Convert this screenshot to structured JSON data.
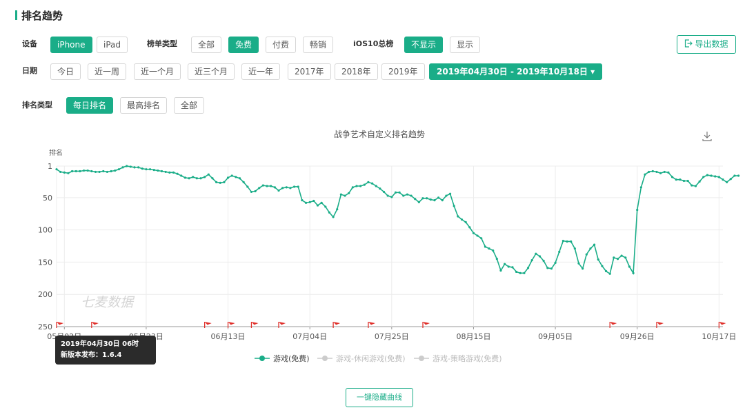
{
  "page": {
    "title": "排名趋势",
    "export_label": "导出数据",
    "hide_curves_label": "一键隐藏曲线",
    "watermark": "七麦数据"
  },
  "filters": {
    "device": {
      "label": "设备",
      "options": [
        "iPhone",
        "iPad"
      ],
      "selected": "iPhone"
    },
    "list_type": {
      "label": "榜单类型",
      "options": [
        "全部",
        "免费",
        "付费",
        "畅销"
      ],
      "selected": "免费"
    },
    "ios10": {
      "label": "iOS10总榜",
      "options": [
        "不显示",
        "显示"
      ],
      "selected": "不显示"
    },
    "date": {
      "label": "日期",
      "options": [
        "今日",
        "近一周",
        "近一个月",
        "近三个月",
        "近一年",
        "2017年",
        "2018年",
        "2019年"
      ],
      "range": "2019年04月30日 - 2019年10月18日 ▾"
    },
    "rank_type": {
      "label": "排名类型",
      "options": [
        "每日排名",
        "最高排名",
        "全部"
      ],
      "selected": "每日排名"
    }
  },
  "tooltip": {
    "line1": "2019年04月30日 06时",
    "line2": "新版本发布：1.6.4"
  },
  "colors": {
    "accent": "#1aad88",
    "flag": "#e0302b",
    "inactive": "#cccccc"
  },
  "icons": {
    "download": "download-icon",
    "export": "export-icon"
  },
  "chart_data": {
    "type": "line",
    "title": "战争艺术自定义排名趋势",
    "ylabel": "排名",
    "y_inverted": true,
    "ylim": [
      1,
      250
    ],
    "yticks": [
      1,
      50,
      100,
      150,
      200,
      250
    ],
    "x_start": "2019-04-30",
    "x_end": "2019-10-18",
    "xticks": [
      "05月02日",
      "05月23日",
      "06月13日",
      "07月04日",
      "07月25日",
      "08月15日",
      "09月05日",
      "09月26日",
      "10月17日"
    ],
    "legend": [
      {
        "name": "游戏(免费)",
        "active": true
      },
      {
        "name": "游戏-休闲游戏(免费)",
        "active": false
      },
      {
        "name": "游戏-策略游戏(免费)",
        "active": false
      }
    ],
    "version_flags": [
      "2019-04-30",
      "2019-05-09",
      "2019-06-07",
      "2019-06-13",
      "2019-06-19",
      "2019-06-26",
      "2019-07-10",
      "2019-07-19",
      "2019-08-02",
      "2019-09-19",
      "2019-10-01",
      "2019-10-17"
    ],
    "series": [
      {
        "name": "游戏(免费)",
        "values": [
          6,
          10,
          11,
          12,
          9,
          9,
          9,
          8,
          8,
          9,
          10,
          10,
          9,
          10,
          9,
          8,
          6,
          3,
          1,
          2,
          3,
          3,
          5,
          6,
          6,
          7,
          8,
          9,
          10,
          11,
          11,
          13,
          16,
          19,
          20,
          18,
          20,
          20,
          18,
          14,
          20,
          26,
          27,
          26,
          19,
          16,
          18,
          20,
          26,
          33,
          41,
          40,
          35,
          31,
          32,
          32,
          34,
          39,
          35,
          34,
          35,
          33,
          33,
          54,
          58,
          57,
          55,
          62,
          58,
          64,
          73,
          80,
          68,
          45,
          47,
          43,
          34,
          32,
          32,
          30,
          26,
          28,
          32,
          36,
          41,
          47,
          49,
          42,
          42,
          47,
          45,
          47,
          52,
          57,
          51,
          51,
          53,
          54,
          50,
          54,
          47,
          44,
          63,
          79,
          84,
          88,
          96,
          105,
          109,
          113,
          126,
          129,
          132,
          145,
          163,
          153,
          157,
          158,
          165,
          167,
          167,
          159,
          147,
          137,
          141,
          148,
          159,
          160,
          151,
          134,
          117,
          118,
          118,
          129,
          152,
          160,
          138,
          129,
          123,
          146,
          156,
          164,
          168,
          143,
          145,
          140,
          143,
          157,
          167,
          69,
          34,
          14,
          10,
          9,
          10,
          12,
          10,
          11,
          18,
          22,
          22,
          24,
          24,
          31,
          32,
          25,
          18,
          15,
          16,
          17,
          18,
          22,
          26,
          21,
          16,
          16
        ]
      }
    ]
  }
}
